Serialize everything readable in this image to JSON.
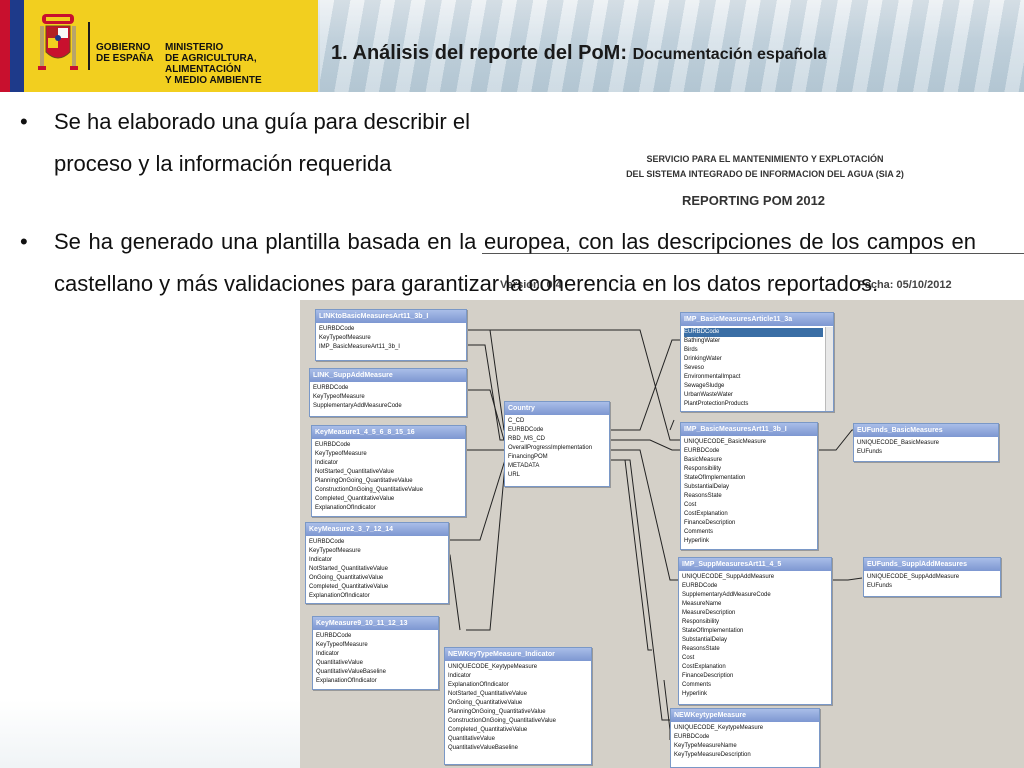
{
  "header": {
    "gov_line1": "GOBIERNO",
    "gov_line2": "DE ESPAÑA",
    "ministry_line1": "MINISTERIO",
    "ministry_line2": "DE AGRICULTURA, ALIMENTACIÓN",
    "ministry_line3": "Y MEDIO AMBIENTE",
    "title": "1. Análisis del reporte del PoM:",
    "subtitle": "Documentación española"
  },
  "bullets": {
    "marker": "•",
    "b1": "Se ha elaborado una guía para describir el proceso y la información requerida",
    "b2": "Se ha generado una plantilla basada en la europea, con las descripciones de los campos en castellano y más validaciones para garantizar la coherencia en los datos reportados."
  },
  "document": {
    "service_line1": "SERVICIO PARA EL MANTENIMIENTO Y EXPLOTACIÓN",
    "service_line2": "DEL SISTEMA INTEGRADO DE INFORMACION DEL AGUA (SIA 2)",
    "reporting_title": "REPORTING POM 2012",
    "version_label": "Versión: 0.4",
    "fecha_label": "Fecha: 05/10/2012"
  },
  "tables": {
    "link_basic": {
      "name": "LINKtoBasicMeasuresArt11_3b_I",
      "fields": [
        "EURBDCode",
        "KeyTypeofMeasure",
        "IMP_BasicMeasureArt11_3b_I"
      ]
    },
    "link_supp": {
      "name": "LINK_SuppAddMeasure",
      "fields": [
        "EURBDCode",
        "KeyTypeofMeasure",
        "SupplementaryAddMeasureCode"
      ]
    },
    "km1": {
      "name": "KeyMeasure1_4_5_6_8_15_16",
      "fields": [
        "EURBDCode",
        "KeyTypeofMeasure",
        "Indicator",
        "NotStarted_QuantitativeValue",
        "PlanningOnGoing_QuantitativeValue",
        "ConstructionOnGoing_QuantitativeValue",
        "Completed_QuantitativeValue",
        "ExplanationOfIndicator"
      ]
    },
    "km2": {
      "name": "KeyMeasure2_3_7_12_14",
      "fields": [
        "EURBDCode",
        "KeyTypeofMeasure",
        "Indicator",
        "NotStarted_QuantitativeValue",
        "OnGoing_QuantitativeValue",
        "Completed_QuantitativeValue",
        "ExplanationOfIndicator"
      ]
    },
    "km9": {
      "name": "KeyMeasure9_10_11_12_13",
      "fields": [
        "EURBDCode",
        "KeyTypeofMeasure",
        "Indicator",
        "QuantitativeValue",
        "QuantitativeValueBaseline",
        "ExplanationOfIndicator"
      ]
    },
    "country": {
      "name": "Country",
      "fields": [
        "C_CD",
        "EURBDCode",
        "RBD_MS_CD",
        "OverallProgressImplementation",
        "FinancingPOM",
        "METADATA",
        "URL"
      ]
    },
    "newkey_ind": {
      "name": "NEWKeyTypeMeasure_Indicator",
      "fields": [
        "UNIQUECODE_KeytypeMeasure",
        "Indicator",
        "ExplanationOfIndicator",
        "NotStarted_QuantitativeValue",
        "OnGoing_QuantitativeValue",
        "PlanningOnGoing_QuantitativeValue",
        "ConstructionOnGoing_QuantitativeValue",
        "Completed_QuantitativeValue",
        "QuantitativeValue",
        "QuantitativeValueBaseline"
      ]
    },
    "imp_art": {
      "name": "IMP_BasicMeasuresArticle11_3a",
      "fields": [
        "EURBDCode",
        "BathingWater",
        "Birds",
        "DrinkingWater",
        "Seveso",
        "EnvironmentalImpact",
        "SewageSludge",
        "UrbanWasteWater",
        "PlantProtectionProducts"
      ]
    },
    "imp_3b": {
      "name": "IMP_BasicMeasuresArt11_3b_I",
      "fields": [
        "UNIQUECODE_BasicMeasure",
        "EURBDCode",
        "BasicMeasure",
        "Responsibility",
        "StateOfImplementation",
        "SubstantialDelay",
        "ReasonsState",
        "Cost",
        "CostExplanation",
        "FinanceDescription",
        "Comments",
        "Hyperlink"
      ]
    },
    "eu_basic": {
      "name": "EUFunds_BasicMeasures",
      "fields": [
        "UNIQUECODE_BasicMeasure",
        "EUFunds"
      ]
    },
    "imp_supp": {
      "name": "IMP_SuppMeasuresArt11_4_5",
      "fields": [
        "UNIQUECODE_SuppAddMeasure",
        "EURBDCode",
        "SupplementaryAddMeasureCode",
        "MeasureName",
        "MeasureDescription",
        "Responsibility",
        "StateOfImplementation",
        "SubstantialDelay",
        "ReasonsState",
        "Cost",
        "CostExplanation",
        "FinanceDescription",
        "Comments",
        "Hyperlink"
      ]
    },
    "eu_supp": {
      "name": "EUFunds_SupplAddMeasures",
      "fields": [
        "UNIQUECODE_SuppAddMeasure",
        "EUFunds"
      ]
    },
    "newkey": {
      "name": "NEWKeytypeMeasure",
      "fields": [
        "UNIQUECODE_KeytypeMeasure",
        "EURBDCode",
        "KeyTypeMeasureName",
        "KeyTypeMeasureDescription"
      ]
    }
  }
}
